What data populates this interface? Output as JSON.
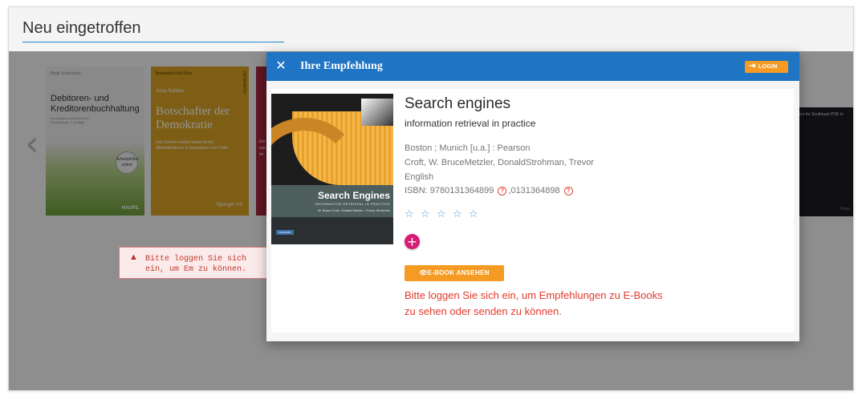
{
  "section": {
    "title": "Neu eingetroffen"
  },
  "carousel": {
    "prev_icon": "chevron-left-icon",
    "book1": {
      "top": "Birgit Schneiders",
      "title": "Debitoren- und Kreditorenbuchhaltung",
      "subtitle": "Grundlagen und Ablauf der Buchhaltung, 4. Auflage",
      "badge": "Arbeitshilfen online",
      "publisher": "HAUFE."
    },
    "book2": {
      "top": "Bearbeitet Rolf Duhr",
      "author": "Anna Kattinis",
      "title": "Botschafter der Demokratie",
      "subtitle": "Das Goethe-Institut während der Militärdiktaturen in Argentinien und Chile",
      "side": "RESEARCH",
      "publisher": "Springer VS"
    },
    "book3": {
      "bits": "Ein\nexp\nfer"
    },
    "book_right": {
      "title": "Spacers for Southeast POE in",
      "bottom": "Roop"
    }
  },
  "alert": {
    "icon": "warning-icon",
    "text": "Bitte loggen Sie sich ein, um Em zu können."
  },
  "modal": {
    "title": "Ihre Empfehlung",
    "close_icon": "close-icon",
    "login_label": "LOGIN",
    "login_icon": "login-icon",
    "cover": {
      "title": "Search Engines",
      "subtitle": "INFORMATION RETRIEVAL IN PRACTICE",
      "authors": "W. Bruce Croft • Donald Metzler • Trevor Strohman",
      "publisher_logo": "PEARSON"
    },
    "book": {
      "title": "Search engines",
      "subtitle": "information retrieval in practice",
      "publisher": "Boston ; Munich [u.a.] : Pearson",
      "authors": "Croft, W. BruceMetzler, DonaldStrohman, Trevor",
      "language": "English",
      "isbn_label": "ISBN: 9780131364899",
      "isbn_second": ",0131364898",
      "rating": 0,
      "rating_max": 5
    },
    "help_icon": "question-circle-icon",
    "star_icon": "star-outline-icon",
    "star_glyph": "☆",
    "add_icon": "plus-icon",
    "ebook_label": "E-BOOK ANSEHEN",
    "ebook_icon": "eye-icon",
    "warning": "Bitte loggen Sie sich ein, um Empfehlungen zu E-Books zu sehen oder senden zu können."
  },
  "colors": {
    "header": "#1f74c4",
    "accent": "#f59b24",
    "add_button": "#d81b73",
    "warning_text": "#e13a2c",
    "star": "#4a9ad6"
  }
}
